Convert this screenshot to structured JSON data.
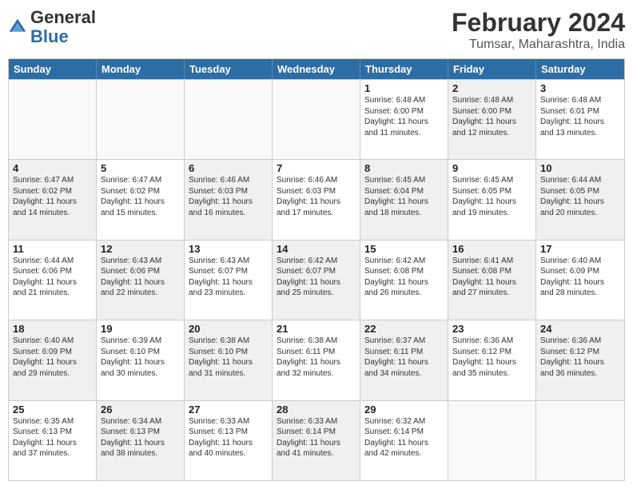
{
  "header": {
    "logo_general": "General",
    "logo_blue": "Blue",
    "month_year": "February 2024",
    "location": "Tumsar, Maharashtra, India"
  },
  "days_of_week": [
    "Sunday",
    "Monday",
    "Tuesday",
    "Wednesday",
    "Thursday",
    "Friday",
    "Saturday"
  ],
  "rows": [
    [
      {
        "day": "",
        "info": "",
        "shaded": false,
        "empty": true
      },
      {
        "day": "",
        "info": "",
        "shaded": false,
        "empty": true
      },
      {
        "day": "",
        "info": "",
        "shaded": false,
        "empty": true
      },
      {
        "day": "",
        "info": "",
        "shaded": false,
        "empty": true
      },
      {
        "day": "1",
        "info": "Sunrise: 6:48 AM\nSunset: 6:00 PM\nDaylight: 11 hours\nand 11 minutes.",
        "shaded": false,
        "empty": false
      },
      {
        "day": "2",
        "info": "Sunrise: 6:48 AM\nSunset: 6:00 PM\nDaylight: 11 hours\nand 12 minutes.",
        "shaded": true,
        "empty": false
      },
      {
        "day": "3",
        "info": "Sunrise: 6:48 AM\nSunset: 6:01 PM\nDaylight: 11 hours\nand 13 minutes.",
        "shaded": false,
        "empty": false
      }
    ],
    [
      {
        "day": "4",
        "info": "Sunrise: 6:47 AM\nSunset: 6:02 PM\nDaylight: 11 hours\nand 14 minutes.",
        "shaded": true,
        "empty": false
      },
      {
        "day": "5",
        "info": "Sunrise: 6:47 AM\nSunset: 6:02 PM\nDaylight: 11 hours\nand 15 minutes.",
        "shaded": false,
        "empty": false
      },
      {
        "day": "6",
        "info": "Sunrise: 6:46 AM\nSunset: 6:03 PM\nDaylight: 11 hours\nand 16 minutes.",
        "shaded": true,
        "empty": false
      },
      {
        "day": "7",
        "info": "Sunrise: 6:46 AM\nSunset: 6:03 PM\nDaylight: 11 hours\nand 17 minutes.",
        "shaded": false,
        "empty": false
      },
      {
        "day": "8",
        "info": "Sunrise: 6:45 AM\nSunset: 6:04 PM\nDaylight: 11 hours\nand 18 minutes.",
        "shaded": true,
        "empty": false
      },
      {
        "day": "9",
        "info": "Sunrise: 6:45 AM\nSunset: 6:05 PM\nDaylight: 11 hours\nand 19 minutes.",
        "shaded": false,
        "empty": false
      },
      {
        "day": "10",
        "info": "Sunrise: 6:44 AM\nSunset: 6:05 PM\nDaylight: 11 hours\nand 20 minutes.",
        "shaded": true,
        "empty": false
      }
    ],
    [
      {
        "day": "11",
        "info": "Sunrise: 6:44 AM\nSunset: 6:06 PM\nDaylight: 11 hours\nand 21 minutes.",
        "shaded": false,
        "empty": false
      },
      {
        "day": "12",
        "info": "Sunrise: 6:43 AM\nSunset: 6:06 PM\nDaylight: 11 hours\nand 22 minutes.",
        "shaded": true,
        "empty": false
      },
      {
        "day": "13",
        "info": "Sunrise: 6:43 AM\nSunset: 6:07 PM\nDaylight: 11 hours\nand 23 minutes.",
        "shaded": false,
        "empty": false
      },
      {
        "day": "14",
        "info": "Sunrise: 6:42 AM\nSunset: 6:07 PM\nDaylight: 11 hours\nand 25 minutes.",
        "shaded": true,
        "empty": false
      },
      {
        "day": "15",
        "info": "Sunrise: 6:42 AM\nSunset: 6:08 PM\nDaylight: 11 hours\nand 26 minutes.",
        "shaded": false,
        "empty": false
      },
      {
        "day": "16",
        "info": "Sunrise: 6:41 AM\nSunset: 6:08 PM\nDaylight: 11 hours\nand 27 minutes.",
        "shaded": true,
        "empty": false
      },
      {
        "day": "17",
        "info": "Sunrise: 6:40 AM\nSunset: 6:09 PM\nDaylight: 11 hours\nand 28 minutes.",
        "shaded": false,
        "empty": false
      }
    ],
    [
      {
        "day": "18",
        "info": "Sunrise: 6:40 AM\nSunset: 6:09 PM\nDaylight: 11 hours\nand 29 minutes.",
        "shaded": true,
        "empty": false
      },
      {
        "day": "19",
        "info": "Sunrise: 6:39 AM\nSunset: 6:10 PM\nDaylight: 11 hours\nand 30 minutes.",
        "shaded": false,
        "empty": false
      },
      {
        "day": "20",
        "info": "Sunrise: 6:38 AM\nSunset: 6:10 PM\nDaylight: 11 hours\nand 31 minutes.",
        "shaded": true,
        "empty": false
      },
      {
        "day": "21",
        "info": "Sunrise: 6:38 AM\nSunset: 6:11 PM\nDaylight: 11 hours\nand 32 minutes.",
        "shaded": false,
        "empty": false
      },
      {
        "day": "22",
        "info": "Sunrise: 6:37 AM\nSunset: 6:11 PM\nDaylight: 11 hours\nand 34 minutes.",
        "shaded": true,
        "empty": false
      },
      {
        "day": "23",
        "info": "Sunrise: 6:36 AM\nSunset: 6:12 PM\nDaylight: 11 hours\nand 35 minutes.",
        "shaded": false,
        "empty": false
      },
      {
        "day": "24",
        "info": "Sunrise: 6:36 AM\nSunset: 6:12 PM\nDaylight: 11 hours\nand 36 minutes.",
        "shaded": true,
        "empty": false
      }
    ],
    [
      {
        "day": "25",
        "info": "Sunrise: 6:35 AM\nSunset: 6:13 PM\nDaylight: 11 hours\nand 37 minutes.",
        "shaded": false,
        "empty": false
      },
      {
        "day": "26",
        "info": "Sunrise: 6:34 AM\nSunset: 6:13 PM\nDaylight: 11 hours\nand 38 minutes.",
        "shaded": true,
        "empty": false
      },
      {
        "day": "27",
        "info": "Sunrise: 6:33 AM\nSunset: 6:13 PM\nDaylight: 11 hours\nand 40 minutes.",
        "shaded": false,
        "empty": false
      },
      {
        "day": "28",
        "info": "Sunrise: 6:33 AM\nSunset: 6:14 PM\nDaylight: 11 hours\nand 41 minutes.",
        "shaded": true,
        "empty": false
      },
      {
        "day": "29",
        "info": "Sunrise: 6:32 AM\nSunset: 6:14 PM\nDaylight: 11 hours\nand 42 minutes.",
        "shaded": false,
        "empty": false
      },
      {
        "day": "",
        "info": "",
        "shaded": false,
        "empty": true
      },
      {
        "day": "",
        "info": "",
        "shaded": false,
        "empty": true
      }
    ]
  ]
}
